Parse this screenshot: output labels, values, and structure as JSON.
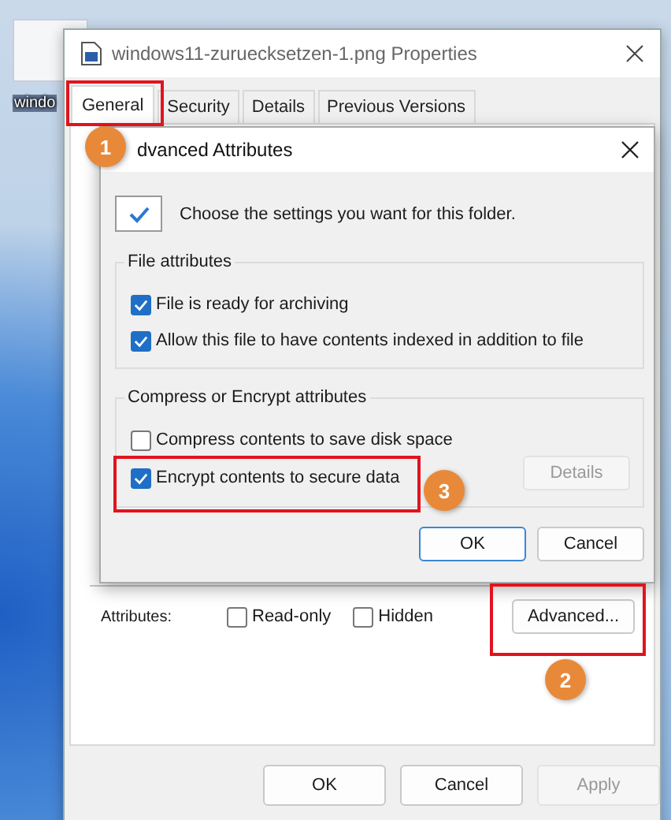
{
  "desktop_icon": {
    "label": "windo"
  },
  "properties_window": {
    "title": "windows11-zuruecksetzen-1.png Properties",
    "tabs": [
      {
        "label": "General",
        "selected": true
      },
      {
        "label": "Security",
        "selected": false
      },
      {
        "label": "Details",
        "selected": false
      },
      {
        "label": "Previous Versions",
        "selected": false
      }
    ],
    "attributes_label": "Attributes:",
    "attribute_checkboxes": [
      {
        "label": "Read-only",
        "checked": false
      },
      {
        "label": "Hidden",
        "checked": false
      }
    ],
    "advanced_button": "Advanced...",
    "buttons": [
      {
        "label": "OK",
        "disabled": false
      },
      {
        "label": "Cancel",
        "disabled": false
      },
      {
        "label": "Apply",
        "disabled": true
      }
    ]
  },
  "advanced_dialog": {
    "title": "dvanced Attributes",
    "intro": "Choose the settings you want for this folder.",
    "groups": [
      {
        "title": "File attributes",
        "options": [
          {
            "label": "File is ready for archiving",
            "checked": true
          },
          {
            "label": "Allow this file to have contents indexed in addition to file",
            "checked": true
          }
        ]
      },
      {
        "title": "Compress or Encrypt attributes",
        "options": [
          {
            "label": "Compress contents to save disk space",
            "checked": false
          },
          {
            "label": "Encrypt contents to secure data",
            "checked": true
          }
        ],
        "details_button": {
          "label": "Details",
          "disabled": true
        }
      }
    ],
    "buttons": [
      {
        "label": "OK",
        "default": true
      },
      {
        "label": "Cancel",
        "default": false
      }
    ]
  },
  "annotations": [
    {
      "number": "1"
    },
    {
      "number": "2"
    },
    {
      "number": "3"
    }
  ]
}
